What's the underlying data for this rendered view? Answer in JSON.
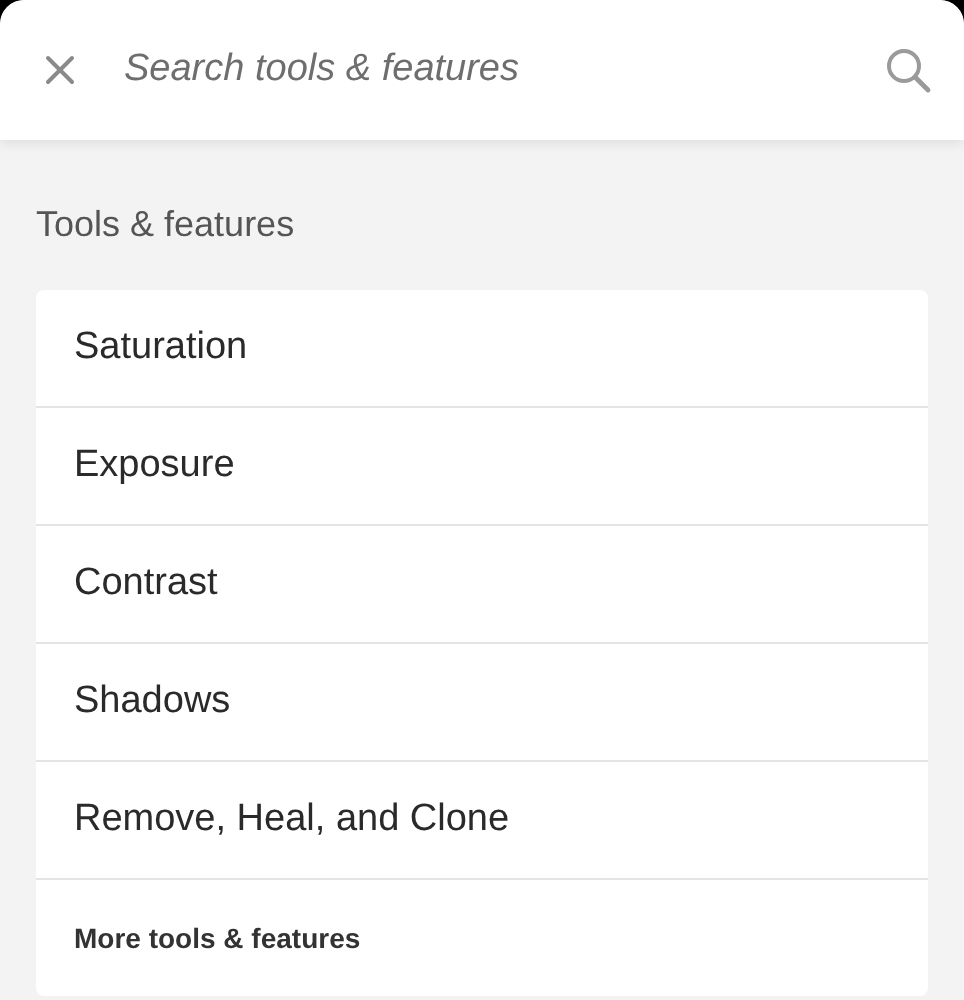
{
  "search": {
    "placeholder": "Search tools & features"
  },
  "section_title": "Tools & features",
  "items": [
    {
      "label": "Saturation",
      "kind": "tool"
    },
    {
      "label": "Exposure",
      "kind": "tool"
    },
    {
      "label": "Contrast",
      "kind": "tool"
    },
    {
      "label": "Shadows",
      "kind": "tool"
    },
    {
      "label": "Remove, Heal, and Clone",
      "kind": "tool"
    },
    {
      "label": "More tools & features",
      "kind": "more"
    }
  ]
}
